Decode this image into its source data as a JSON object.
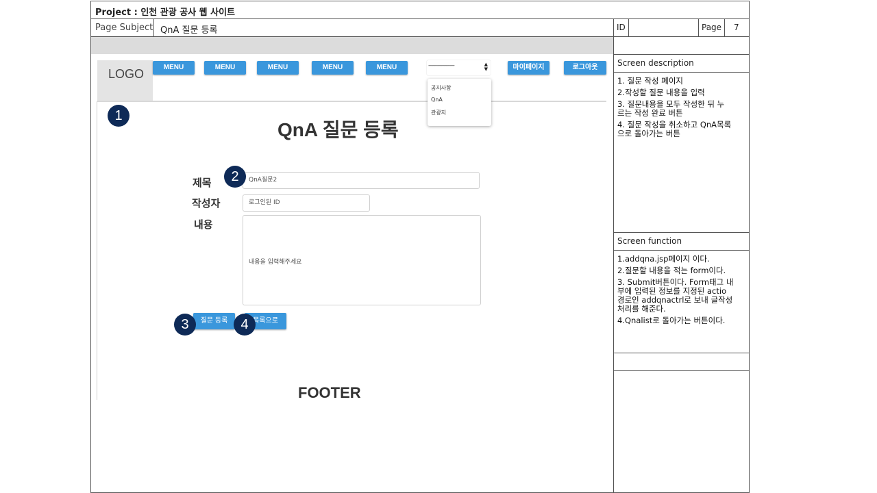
{
  "header": {
    "project": "Project : 인천 관광 공사 웹 사이트",
    "page_subject_label": "Page Subject",
    "page_subject_value": "QnA 질문 등록",
    "id_label": "ID",
    "id_value": "",
    "page_label": "Page",
    "page_value": "7"
  },
  "nav": {
    "logo": "LOGO",
    "menus": [
      "MENU",
      "MENU",
      "MENU",
      "MENU",
      "MENU"
    ],
    "select_value": "--------------------",
    "dropdown_options": [
      "공지사항",
      "QnA",
      "관광지"
    ],
    "mypage": "마이페이지",
    "logout": "로그아웃"
  },
  "page": {
    "title": "QnA 질문 등록",
    "form": {
      "title_label": "제목",
      "title_value": "QnA질문2",
      "author_label": "작성자",
      "author_value": "로그인된 ID",
      "content_label": "내용",
      "content_placeholder": "내용을 입력해주세요"
    },
    "submit_label": "질문 등록",
    "list_label": "목록으로",
    "footer": "FOOTER"
  },
  "badges": [
    "1",
    "2",
    "3",
    "4"
  ],
  "side": {
    "description_title": "Screen description",
    "description_lines": [
      "1. 질문 작성 페이지",
      "2.작성할 질문 내용을 입력",
      "3. 질문내용을 모두 작성한 뒤 누",
      "르는 작성 완료 버튼",
      "4. 질문 작성을 취소하고 QnA목록",
      "으로 돌아가는 버튼"
    ],
    "function_title": "Screen function",
    "function_lines": [
      "1.addqna.jsp페이지 이다.",
      "2.질문할 내용을 적는 form이다.",
      "3. Submit버튼이다. Form태그 내",
      "부에 입력된 정보를 지정된 actio",
      "경로인 addqnactrl로 보내 글작성",
      "처리를 해준다.",
      "4.Qnalist로 돌아가는 버튼이다."
    ]
  },
  "colors": {
    "button_blue": "#3a97dc",
    "badge_navy": "#0e2a57",
    "gray_bar": "#dcdcdc"
  }
}
